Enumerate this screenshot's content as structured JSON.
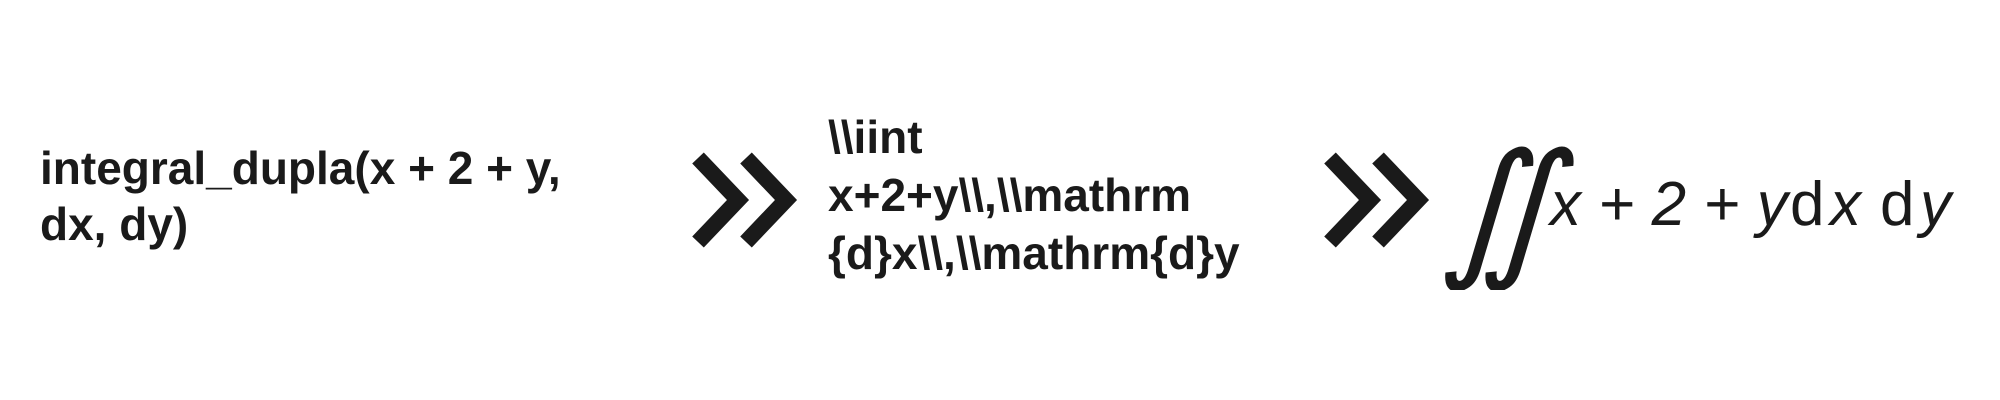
{
  "source": {
    "lines": [
      "integral_dupla(x + 2 + y,",
      "dx, dy)"
    ]
  },
  "latex": {
    "lines": [
      "\\\\iint",
      "x+2+y\\\\,\\\\mathrm",
      "{d}x\\\\,\\\\mathrm{d}y"
    ]
  },
  "rendered": {
    "integral_symbol": "∬",
    "expression": "x + 2 + y",
    "dx_d": "d",
    "dx_var": "x",
    "dy_d": "d",
    "dy_var": "y"
  },
  "icons": {
    "arrow_1": "double-chevron-right-icon",
    "arrow_2": "double-chevron-right-icon"
  },
  "colors": {
    "ink": "#1a1a1a",
    "background": "#ffffff"
  }
}
